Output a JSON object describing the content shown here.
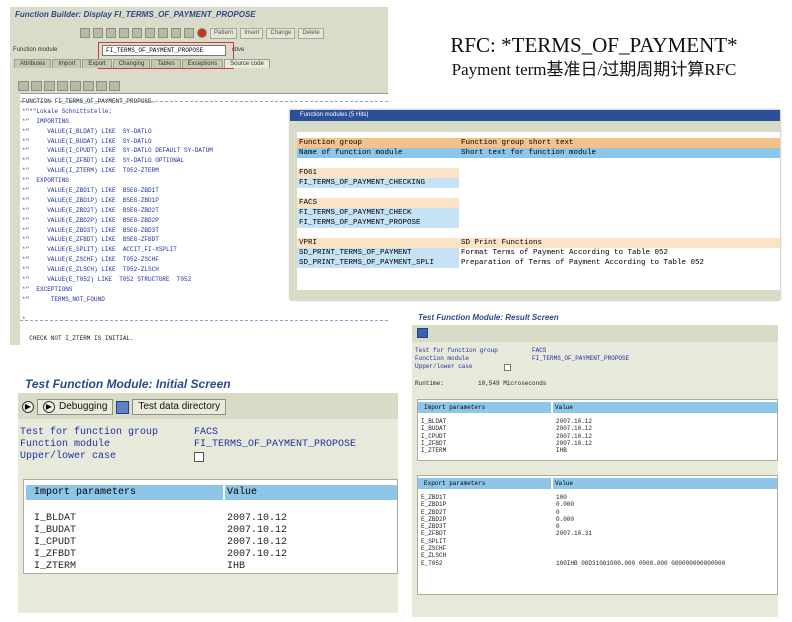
{
  "slide_title": {
    "line1": "RFC: *TERMS_OF_PAYMENT*",
    "line2": "Payment term基准日/过期周期计算RFC"
  },
  "function_builder": {
    "title": "Function Builder: Display FI_TERMS_OF_PAYMENT_PROPOSE",
    "toolbar_labels": [
      "Pattern",
      "Insert",
      "Change",
      "Delete"
    ],
    "function_module_label": "Function module",
    "function_module_value": "FI_TERMS_OF_PAYMENT_PROPOSE",
    "status": "ctive",
    "tabs": [
      "Attributes",
      "Import",
      "Export",
      "Changing",
      "Tables",
      "Exceptions",
      "Source code"
    ],
    "selected_tab": "Source code",
    "code_lines": [
      "FUNCTION FI_TERMS_OF_PAYMENT_PROPOSE.",
      "*\"*\"Lokale Schnittstelle:",
      "*\"  IMPORTING",
      "*\"     VALUE(I_BLDAT) LIKE  SY-DATLO",
      "*\"     VALUE(I_BUDAT) LIKE  SY-DATLO",
      "*\"     VALUE(I_CPUDT) LIKE  SY-DATLO DEFAULT SY-DATUM",
      "*\"     VALUE(I_ZFBDT) LIKE  SY-DATLO OPTIONAL",
      "*\"     VALUE(I_ZTERM) LIKE  T052-ZTERM",
      "*\"  EXPORTING",
      "*\"     VALUE(E_ZBD1T) LIKE  BSEG-ZBD1T",
      "*\"     VALUE(E_ZBD1P) LIKE  BSEG-ZBD1P",
      "*\"     VALUE(E_ZBD2T) LIKE  BSEG-ZBD2T",
      "*\"     VALUE(E_ZBD2P) LIKE  BSEG-ZBD2P",
      "*\"     VALUE(E_ZBD3T) LIKE  BSEG-ZBD3T",
      "*\"     VALUE(E_ZFBDT) LIKE  BSEG-ZFBDT",
      "*\"     VALUE(E_SPLIT) LIKE  ACCIT_FI-XSPLIT",
      "*\"     VALUE(E_ZSCHF) LIKE  T052-ZSCHF",
      "*\"     VALUE(E_ZLSCH) LIKE  T052-ZLSCH",
      "*\"     VALUE(E_T052) LIKE  T052 STRUCTURE  T052",
      "*\"  EXCEPTIONS",
      "*\"      TERMS_NOT_FOUND",
      "",
      "*",
      "",
      "  CHECK NOT I_ZTERM IS INITIAL."
    ]
  },
  "function_modules": {
    "title": "Function modules (5 Hits)",
    "header": {
      "col1": "Function group",
      "col2": "Function group short text"
    },
    "subheader": {
      "col1": "Name of function module",
      "col2": "Short text for function module"
    },
    "groups": [
      {
        "group": "FO61",
        "group_text": "",
        "items": [
          {
            "name": "FI_TERMS_OF_PAYMENT_CHECKING",
            "text": ""
          }
        ]
      },
      {
        "group": "FACS",
        "group_text": "",
        "items": [
          {
            "name": "FI_TERMS_OF_PAYMENT_CHECK",
            "text": ""
          },
          {
            "name": "FI_TERMS_OF_PAYMENT_PROPOSE",
            "text": ""
          }
        ]
      },
      {
        "group": "VPRI",
        "group_text": "SD Print Functions",
        "items": [
          {
            "name": "SD_PRINT_TERMS_OF_PAYMENT",
            "text": "Format Terms of Payment According to Table 052"
          },
          {
            "name": "SD_PRINT_TERMS_OF_PAYMENT_SPLI",
            "text": "Preparation of Terms of Payment According to Table 052"
          }
        ]
      }
    ]
  },
  "result_screen": {
    "title": "Test Function Module: Result Screen",
    "fields": [
      {
        "label": "Test for function group",
        "value": "FACS"
      },
      {
        "label": "Function module",
        "value": "FI_TERMS_OF_PAYMENT_PROPOSE"
      },
      {
        "label": "Upper/lower case",
        "value": ""
      }
    ],
    "runtime_label": "Runtime:",
    "runtime_value": "10,549 Microseconds",
    "import": {
      "header": [
        "Import parameters",
        "Value"
      ],
      "names": [
        "I_BLDAT",
        "I_BUDAT",
        "I_CPUDT",
        "I_ZFBDT",
        "I_ZTERM"
      ],
      "values": [
        "2007.10.12",
        "2007.10.12",
        "2007.10.12",
        "2007.10.12",
        "IHB"
      ]
    },
    "export": {
      "header": [
        "Export parameters",
        "Value"
      ],
      "names": [
        "E_ZBD1T",
        "E_ZBD1P",
        "E_ZBD2T",
        "E_ZBD2P",
        "E_ZBD3T",
        "E_ZFBDT",
        "E_SPLIT",
        "E_ZSCHF",
        "E_ZLSCH",
        "E_T052"
      ],
      "values": [
        "100",
        "0.000",
        "0",
        "0.000",
        "0",
        "2007.10.31",
        "",
        "",
        "",
        "100IHB 00D31001000.000 0000.000 000000000000000"
      ]
    }
  },
  "initial_screen": {
    "title": "Test Function Module: Initial Screen",
    "toolbar": {
      "debugging": "Debugging",
      "test_data_directory": "Test data directory"
    },
    "fields": [
      {
        "label": "Test for function group",
        "value": "FACS"
      },
      {
        "label": "Function module",
        "value": "FI_TERMS_OF_PAYMENT_PROPOSE"
      },
      {
        "label": "Upper/lower case",
        "value": ""
      }
    ],
    "import": {
      "header": [
        "Import parameters",
        "Value"
      ],
      "names": [
        "I_BLDAT",
        "I_BUDAT",
        "I_CPUDT",
        "I_ZFBDT",
        "I_ZTERM"
      ],
      "values": [
        "2007.10.12",
        "2007.10.12",
        "2007.10.12",
        "2007.10.12",
        "IHB"
      ]
    }
  },
  "colors": {
    "sap_frame": "#d8dcc6",
    "header_orange": "#f4c288",
    "header_blue": "#8ec6ea",
    "title_blue": "#2a4a8a",
    "highlight_red": "#d23a3a"
  }
}
